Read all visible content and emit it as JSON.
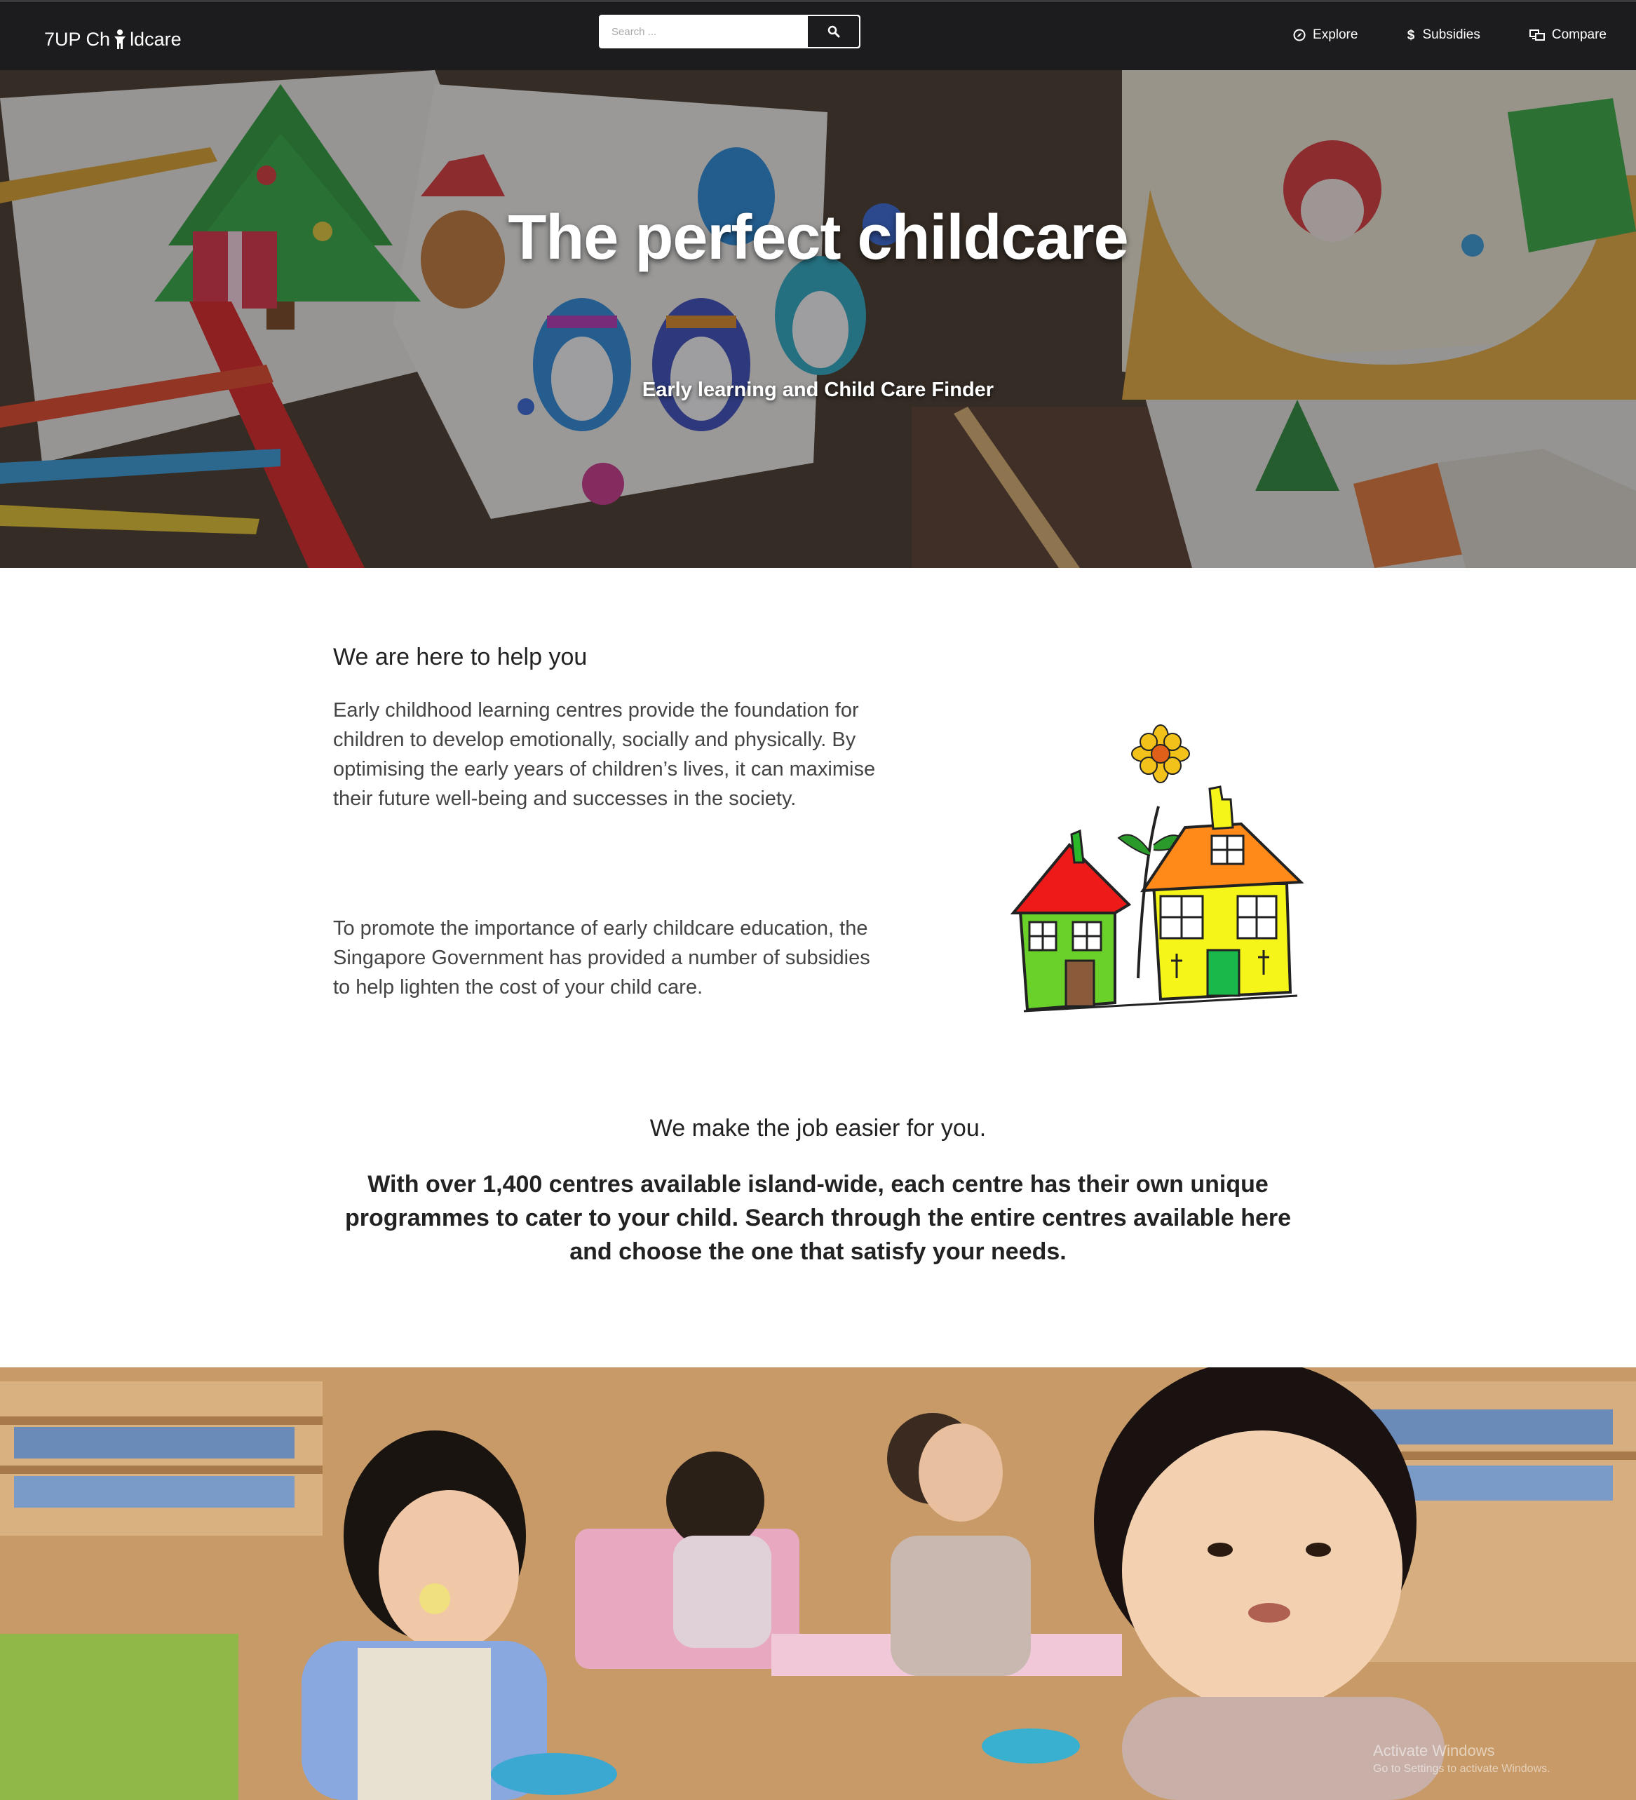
{
  "navbar": {
    "brand_prefix": "7UP Ch",
    "brand_suffix": "ldcare",
    "search_placeholder": "Search ...",
    "items": [
      {
        "label": "Explore",
        "icon": "compass-icon"
      },
      {
        "label": "Subsidies",
        "icon": "dollar-icon"
      },
      {
        "label": "Compare",
        "icon": "compare-icon"
      }
    ]
  },
  "hero": {
    "title": "The perfect childcare",
    "subtitle": "Early learning and Child Care Finder"
  },
  "about": {
    "heading": "We are here to help you",
    "paragraph1": "Early childhood learning centres provide the foundation for children to develop emotionally, socially and physically. By optimising the early years of children’s lives, it can maximise their future well-being and successes in the society.",
    "paragraph2": "To promote the importance of early childcare education, the Singapore Government has provided a number of subsidies to help lighten the cost of your child care."
  },
  "feature": {
    "heading": "We make the job easier for you.",
    "text": "With over 1,400 centres available island-wide, each centre has their own unique programmes to cater to your child. Search through the entire centres available here and choose the one that satisfy your needs."
  },
  "watermark": {
    "line1": "Activate Windows",
    "line2": "Go to Settings to activate Windows."
  }
}
